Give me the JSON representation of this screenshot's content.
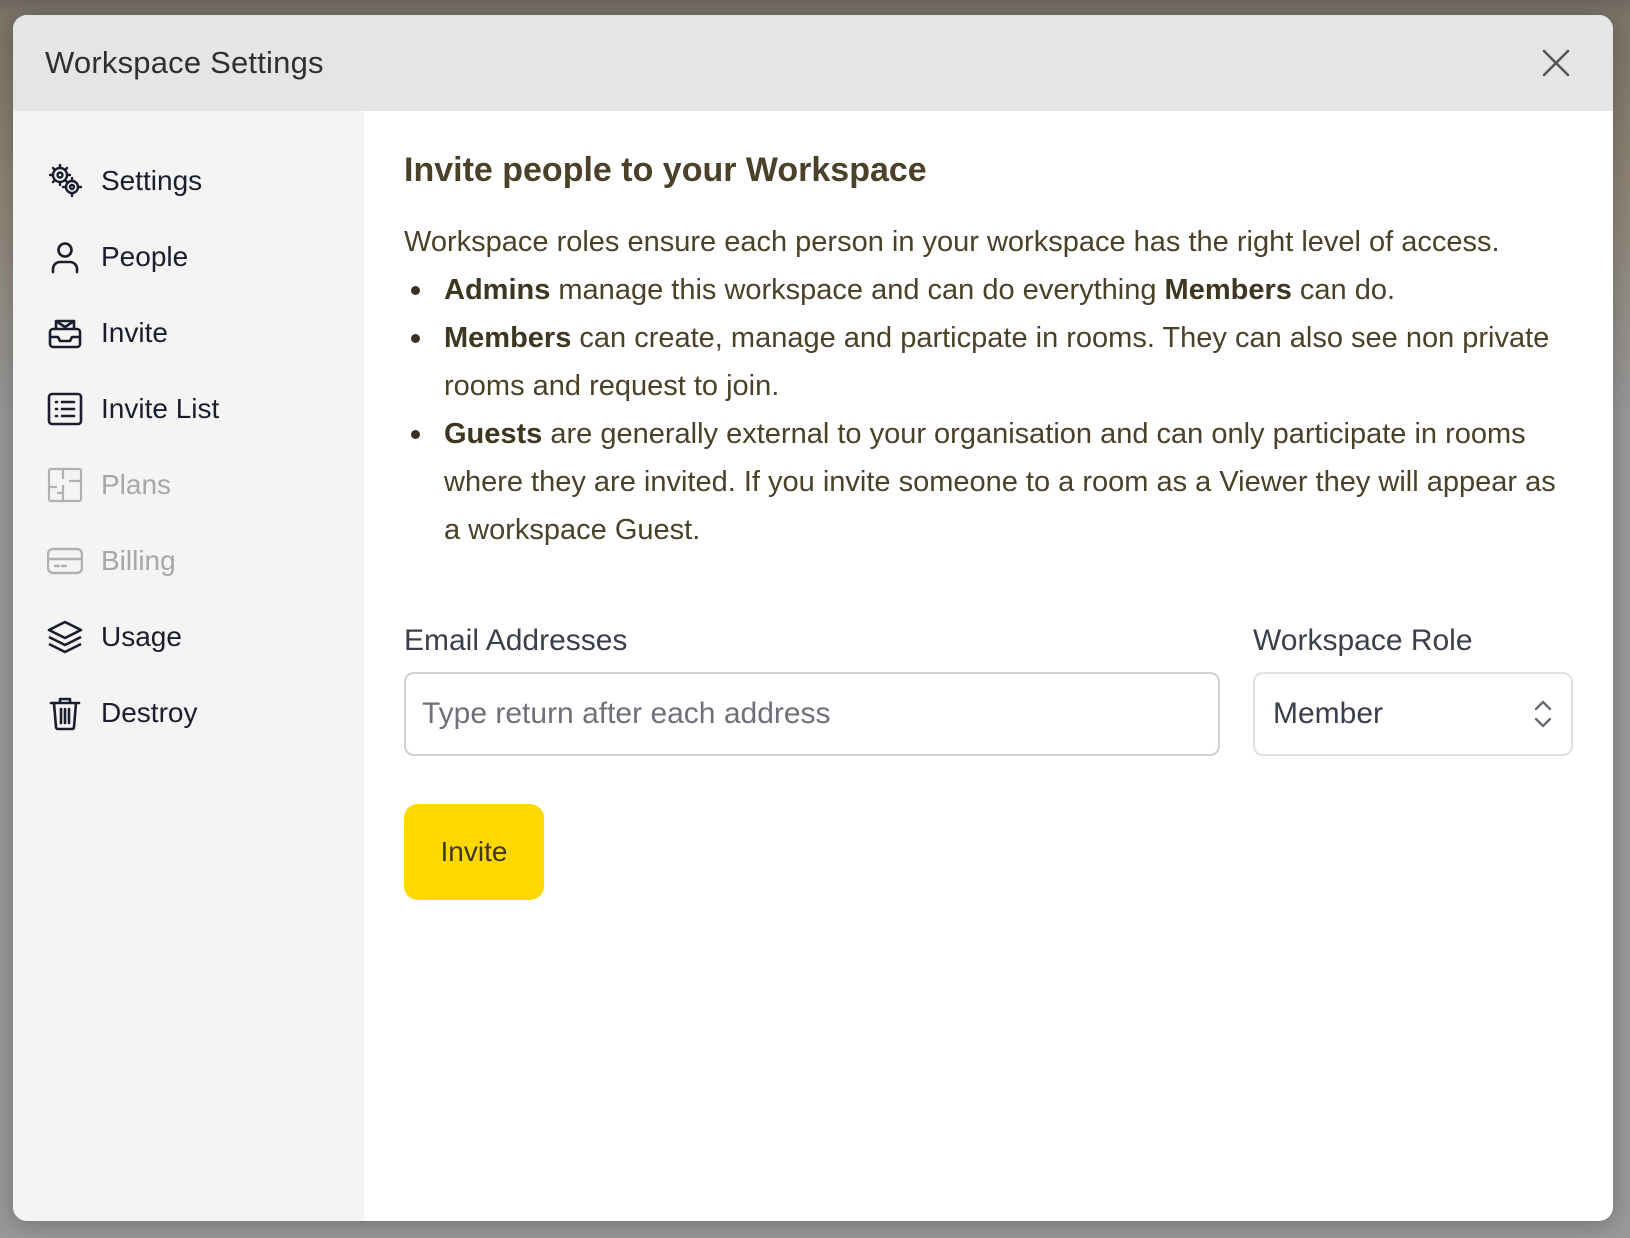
{
  "modal": {
    "title": "Workspace Settings"
  },
  "sidebar": {
    "items": [
      {
        "label": "Settings",
        "icon": "gears-icon",
        "disabled": false
      },
      {
        "label": "People",
        "icon": "person-icon",
        "disabled": false
      },
      {
        "label": "Invite",
        "icon": "inbox-icon",
        "disabled": false
      },
      {
        "label": "Invite List",
        "icon": "list-icon",
        "disabled": false
      },
      {
        "label": "Plans",
        "icon": "floorplan-icon",
        "disabled": true
      },
      {
        "label": "Billing",
        "icon": "credit-card-icon",
        "disabled": true
      },
      {
        "label": "Usage",
        "icon": "layers-icon",
        "disabled": false
      },
      {
        "label": "Destroy",
        "icon": "trash-icon",
        "disabled": false
      }
    ]
  },
  "main": {
    "title": "Invite people to your Workspace",
    "description": "Workspace roles ensure each person in your workspace has the right level of access.",
    "roles": [
      {
        "name": "Admins",
        "text_a": " manage this workspace and can do everything ",
        "name2": "Members",
        "text_b": " can do."
      },
      {
        "name": "Members",
        "text": " can create, manage and particpate in rooms. They can also see non private rooms and request to join."
      },
      {
        "name": "Guests",
        "text": " are generally external to your organisation and can only participate in rooms where they are invited. If you invite someone to a room as a Viewer they will appear as a workspace Guest."
      }
    ],
    "email_label": "Email Addresses",
    "email_placeholder": "Type return after each address",
    "email_value": "",
    "role_label": "Workspace Role",
    "role_value": "Member",
    "invite_button": "Invite"
  },
  "colors": {
    "accent": "#ffd800",
    "sidebar_bg": "#f4f4f5",
    "header_bg": "#e5e5e5",
    "text_dark": "#4a4128"
  }
}
